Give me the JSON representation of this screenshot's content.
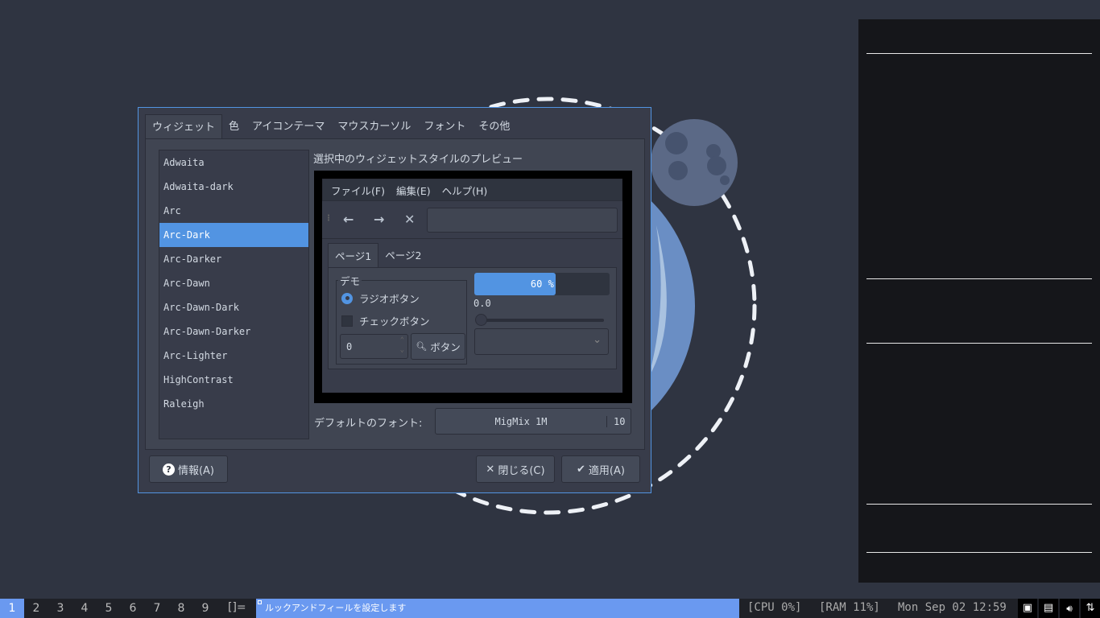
{
  "dialog": {
    "tabs": [
      "ウィジェット",
      "色",
      "アイコンテーマ",
      "マウスカーソル",
      "フォント",
      "その他"
    ],
    "themes": [
      "Adwaita",
      "Adwaita-dark",
      "Arc",
      "Arc-Dark",
      "Arc-Darker",
      "Arc-Dawn",
      "Arc-Dawn-Dark",
      "Arc-Dawn-Darker",
      "Arc-Lighter",
      "HighContrast",
      "Raleigh"
    ],
    "selected_theme": "Arc-Dark",
    "preview_label": "選択中のウィジェットスタイルのプレビュー",
    "preview": {
      "menu": [
        "ファイル(F)",
        "編集(E)",
        "ヘルプ(H)"
      ],
      "tabs": [
        "ページ1",
        "ページ2"
      ],
      "frame_label": "デモ",
      "radio": "ラジオボタン",
      "check": "チェックボタン",
      "spin_value": "0",
      "button": "ボタン",
      "progress_text": "60 %",
      "progress": 0.6,
      "scale_value": "0.0"
    },
    "font_label": "デフォルトのフォント:",
    "font_name": "MigMix 1M",
    "font_size": "10",
    "about": "情報(A)",
    "close": "閉じる(C)",
    "apply": "適用(A)"
  },
  "taskbar": {
    "workspaces": [
      "1",
      "2",
      "3",
      "4",
      "5",
      "6",
      "7",
      "8",
      "9"
    ],
    "layout": "[]=",
    "title": "ルックアンドフィールを設定します",
    "cpu": "[CPU 0%]",
    "ram": "[RAM 11%]",
    "clock": "Mon Sep 02 12:59"
  }
}
